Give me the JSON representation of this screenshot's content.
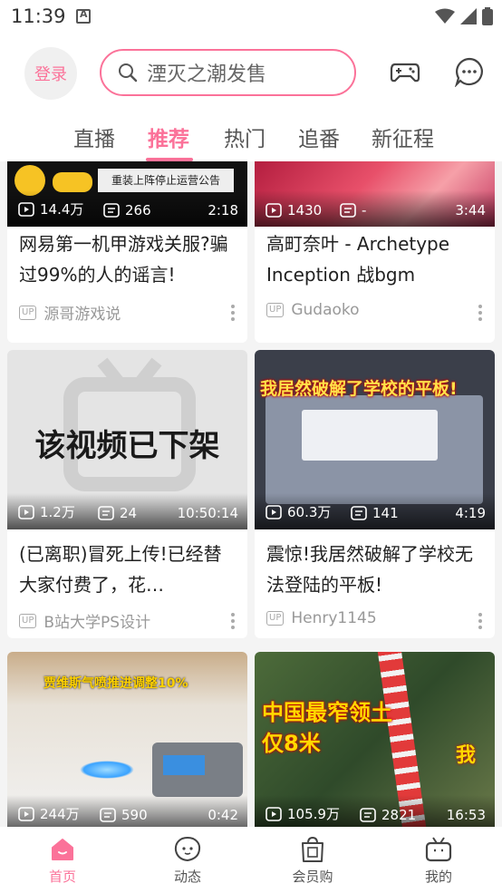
{
  "status_bar": {
    "time": "11:39",
    "icons": [
      "notification-a-icon",
      "wifi-icon",
      "signal-icon",
      "battery-icon"
    ]
  },
  "header": {
    "login_label": "登录",
    "search_text": "湮灭之潮发售",
    "icons": [
      "game-controller-icon",
      "messages-icon"
    ]
  },
  "tabs": [
    {
      "label": "直播"
    },
    {
      "label": "推荐",
      "active": true
    },
    {
      "label": "热门"
    },
    {
      "label": "追番"
    },
    {
      "label": "新征程"
    }
  ],
  "feed": {
    "cards": [
      {
        "thumb_text": "重装上阵停止运营公告",
        "views": "14.4万",
        "danmaku": "266",
        "duration": "2:18",
        "title": "网易第一机甲游戏关服?骗过99%的人的谣言!",
        "up": "源哥游戏说"
      },
      {
        "thumb_text": "",
        "views": "1430",
        "danmaku": "-",
        "duration": "3:44",
        "title": "高町奈叶 - Archetype Inception 战bgm",
        "up": "Gudaoko"
      },
      {
        "thumb_text": "该视频已下架",
        "views": "1.2万",
        "danmaku": "24",
        "duration": "10:50:14",
        "title": "(已离职)冒死上传!已经替大家付费了，花…",
        "up": "B站大学PS设计"
      },
      {
        "thumb_text": "我居然破解了学校的平板!",
        "views": "60.3万",
        "danmaku": "141",
        "duration": "4:19",
        "title": "震惊!我居然破解了学校无法登陆的平板!",
        "up": "Henry1145"
      },
      {
        "thumb_text": "贾维斯气喷推进调整10%",
        "views": "244万",
        "danmaku": "590",
        "duration": "0:42",
        "title": "",
        "up": ""
      },
      {
        "thumb_text": "中国最窄领土 仅8米",
        "thumb_text_2": "我",
        "views": "105.9万",
        "danmaku": "2821",
        "duration": "16:53",
        "title": "",
        "up": ""
      }
    ],
    "up_badge": "UP"
  },
  "bottom_nav": [
    {
      "label": "首页",
      "icon": "home-icon",
      "active": true
    },
    {
      "label": "动态",
      "icon": "dynamic-icon"
    },
    {
      "label": "会员购",
      "icon": "shopping-bag-icon"
    },
    {
      "label": "我的",
      "icon": "tv-profile-icon"
    }
  ],
  "colors": {
    "accent": "#fb7299",
    "background": "#f4f4f4"
  }
}
